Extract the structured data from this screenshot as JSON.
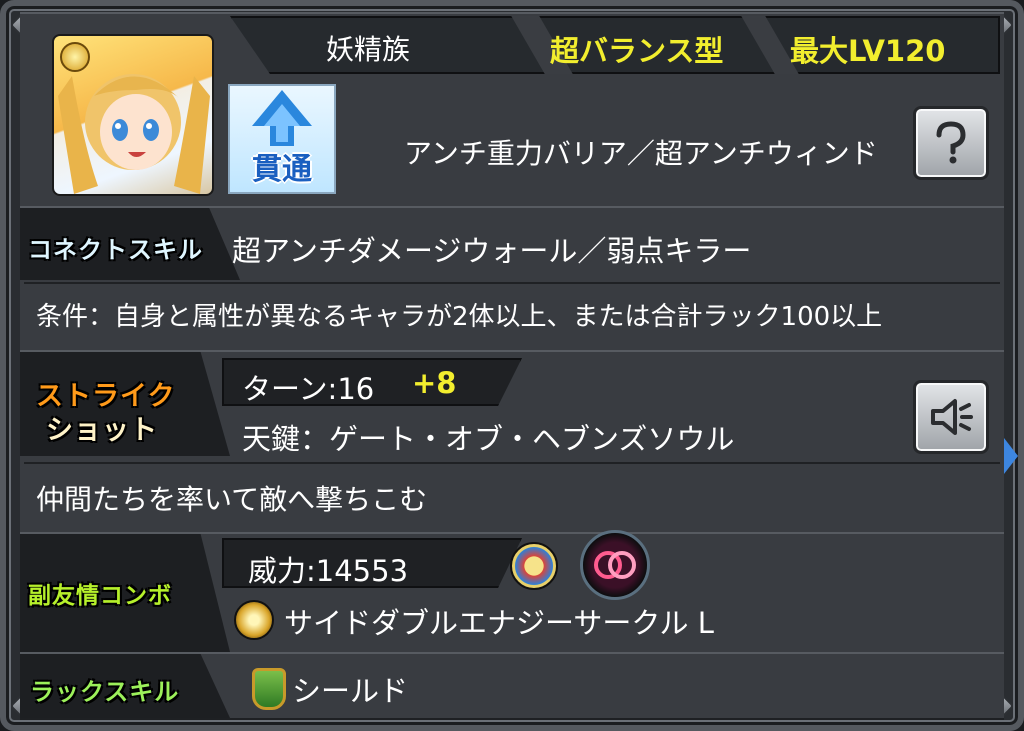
{
  "header": {
    "tribe": "妖精族",
    "type": "超バランス型",
    "max_level": "最大LV120"
  },
  "character": {
    "ability_icon_text": "貫通",
    "abilities": "アンチ重力バリア／超アンチウィンド"
  },
  "connect_skill": {
    "label": "コネクトスキル",
    "name": "超アンチダメージウォール／弱点キラー",
    "condition": "条件：自身と属性が異なるキャラが2体以上、または合計ラック100以上"
  },
  "strike_shot": {
    "label_line1": "ストライク",
    "label_line2": "ショット",
    "turn_prefix": "ターン:16",
    "turn_bonus": "+8",
    "name": "天鍵：ゲート・オブ・ヘブンズソウル",
    "description": "仲間たちを率いて敵へ撃ちこむ"
  },
  "sub_combo": {
    "label": "副友情コンボ",
    "power": "威力:14553",
    "name": "サイドダブルエナジーサークル L"
  },
  "luck_skill": {
    "label": "ラックスキル",
    "name": "シールド"
  },
  "colors": {
    "panel": "#393c41",
    "strip": "#1f2124",
    "yellow": "#f2ee2e",
    "connect_label": "#dff6ff",
    "strike_label": "#ff9a1a",
    "combo_label": "#b6f02b",
    "luck_label": "#9cf05a"
  }
}
